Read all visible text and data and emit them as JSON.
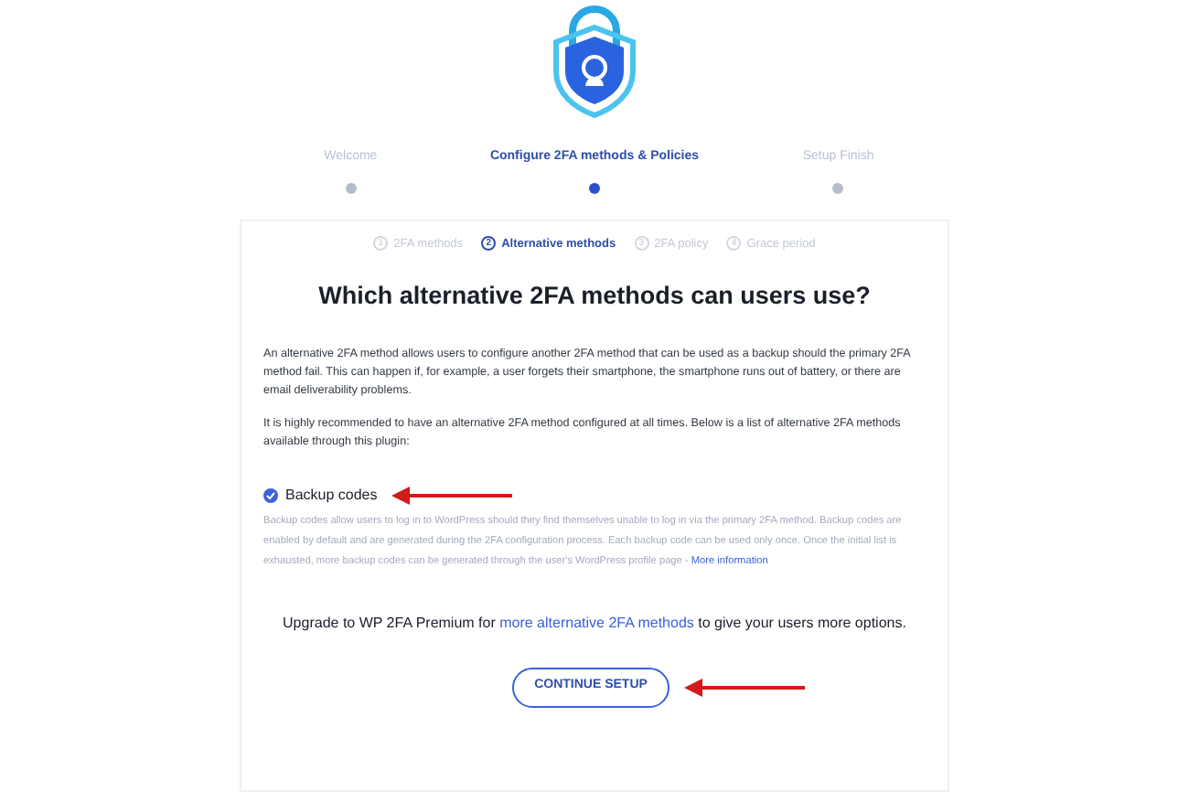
{
  "steps": [
    {
      "label": "Welcome",
      "selected": false
    },
    {
      "label": "Configure 2FA methods & Policies",
      "selected": true
    },
    {
      "label": "Setup Finish",
      "selected": false
    }
  ],
  "substeps": [
    {
      "number": "1",
      "label": "2FA methods",
      "selected": false
    },
    {
      "number": "2",
      "label": "Alternative methods",
      "selected": true
    },
    {
      "number": "3",
      "label": "2FA policy",
      "selected": false
    },
    {
      "number": "4",
      "label": "Grace period",
      "selected": false
    }
  ],
  "heading": "Which alternative 2FA methods can users use?",
  "paragraphs": [
    "An alternative 2FA method allows users to configure another 2FA method that can be used as a backup should the primary 2FA method fail. This can happen if, for example, a user forgets their smartphone, the smartphone runs out of battery, or there are email deliverability problems.",
    "It is highly recommended to have an alternative 2FA method configured at all times. Below is a list of alternative 2FA methods available through this plugin:"
  ],
  "methods": [
    {
      "label": "Backup codes",
      "checked": true,
      "description": "Backup codes allow users to log in to WordPress should they find themselves unable to log in via the primary 2FA method. Backup codes are enabled by default and are generated during the 2FA configuration process. Each backup code can be used only once. Once the initial list is exhausted, more backup codes can be generated through the user's WordPress profile page - ",
      "link": "More information"
    }
  ],
  "upgrade": {
    "before": "Upgrade to WP 2FA Premium for ",
    "link": "more alternative 2FA methods",
    "after": " to give your users more options."
  },
  "button": "CONTINUE SETUP"
}
